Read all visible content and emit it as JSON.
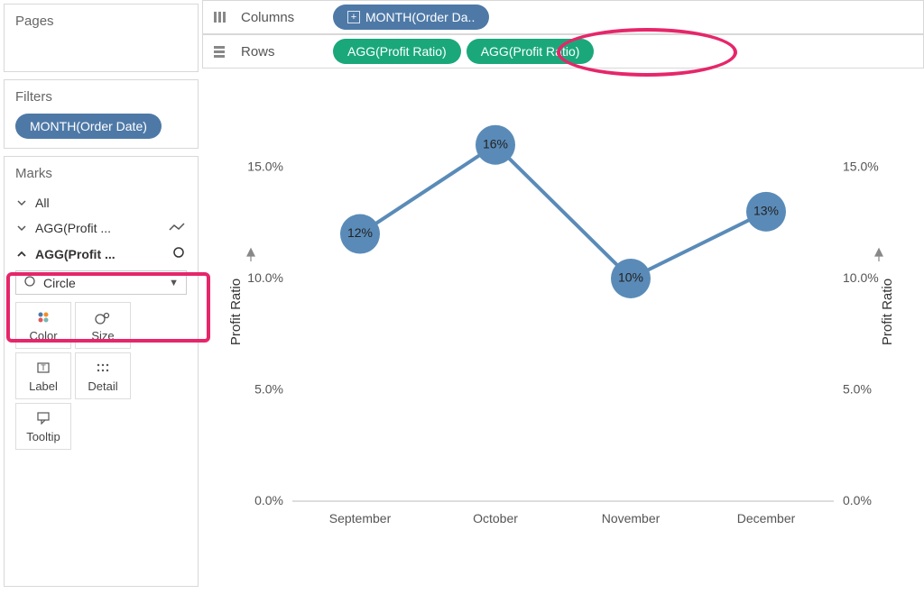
{
  "left": {
    "pages_title": "Pages",
    "filters_title": "Filters",
    "filter_pill": "MONTH(Order Date)",
    "marks_title": "Marks",
    "marks_all": "All",
    "marks_agg1": "AGG(Profit ...",
    "marks_agg2": "AGG(Profit ...",
    "mark_type": "Circle",
    "btn_color": "Color",
    "btn_size": "Size",
    "btn_label": "Label",
    "btn_detail": "Detail",
    "btn_tooltip": "Tooltip"
  },
  "shelves": {
    "columns_label": "Columns",
    "rows_label": "Rows",
    "columns_pill": "MONTH(Order Da..",
    "rows_pill1": "AGG(Profit Ratio)",
    "rows_pill2": "AGG(Profit Ratio)"
  },
  "chart_data": {
    "type": "line",
    "categories": [
      "September",
      "October",
      "November",
      "December"
    ],
    "values": [
      0.12,
      0.16,
      0.1,
      0.13
    ],
    "point_labels": [
      "12%",
      "16%",
      "10%",
      "13%"
    ],
    "ylabel": "Profit Ratio",
    "ylabel_right": "Profit Ratio",
    "ylim": [
      0,
      0.17
    ],
    "yticks": [
      0.0,
      0.05,
      0.1,
      0.15
    ],
    "ytick_labels": [
      "0.0%",
      "5.0%",
      "10.0%",
      "15.0%"
    ]
  }
}
